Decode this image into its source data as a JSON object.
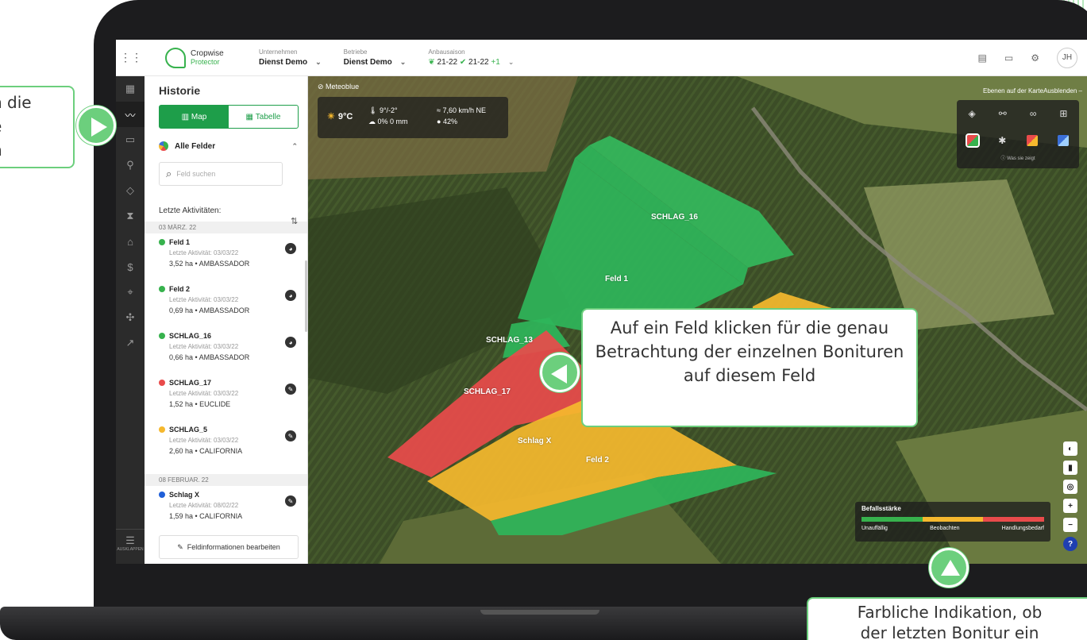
{
  "topbar": {
    "logo_name": "Cropwise",
    "logo_sub": "Protector",
    "unternehmen_label": "Unternehmen",
    "unternehmen_value": "Dienst Demo",
    "betriebe_label": "Betriebe",
    "betriebe_value": "Dienst Demo",
    "season_label": "Anbausaison",
    "season_a": "21-22",
    "season_b": "21-22",
    "season_more": "+1",
    "user_initials": "JH"
  },
  "panel": {
    "title": "Historie",
    "map_tab": "Map",
    "table_tab": "Tabelle",
    "filter": "Alle Felder",
    "search_placeholder": "Feld suchen",
    "recent_label": "Letzte Aktivitäten:",
    "date1": "03 MÄRZ. 22",
    "date2": "08 FEBRUAR. 22",
    "items": [
      {
        "name": "Feld 1",
        "activity": "Letzte Aktivität: 03/03/22",
        "info": "3,52 ha • AMBASSADOR",
        "color": "#37b24d"
      },
      {
        "name": "Feld 2",
        "activity": "Letzte Aktivität: 03/03/22",
        "info": "0,69 ha • AMBASSADOR",
        "color": "#37b24d"
      },
      {
        "name": "SCHLAG_16",
        "activity": "Letzte Aktivität: 03/03/22",
        "info": "0,66 ha • AMBASSADOR",
        "color": "#37b24d"
      },
      {
        "name": "SCHLAG_17",
        "activity": "Letzte Aktivität: 03/03/22",
        "info": "1,52 ha • EUCLIDE",
        "color": "#e94b4b"
      },
      {
        "name": "SCHLAG_5",
        "activity": "Letzte Aktivität: 03/03/22",
        "info": "2,60 ha • CALIFORNIA",
        "color": "#f5b82e"
      },
      {
        "name": "Schlag X",
        "activity": "Letzte Aktivität: 08/02/22",
        "info": "1,59 ha • CALIFORNIA",
        "color": "#1f5fd8"
      }
    ],
    "edit_button": "Feldinformationen bearbeiten",
    "collapse_label": "AUSKLAPPEN"
  },
  "map": {
    "meteo_label": "Meteoblue",
    "temp": "9°C",
    "temp_range": "9°/-2°",
    "rain": "0% 0 mm",
    "wind": "7,60 km/h NE",
    "humidity": "42%",
    "layers_label": "Ebenen auf der KarteAusblenden –",
    "layers_hint": "Was sie zeigt",
    "field_labels": {
      "schlag16": "SCHLAG_16",
      "feld1": "Feld 1",
      "schlag13": "SCHLAG_13",
      "schlag17": "SCHLAG_17",
      "schlagx": "Schlag X",
      "feld2": "Feld 2"
    },
    "legend": {
      "title": "Befallsstärke",
      "low": "Unauffällig",
      "mid": "Beobachten",
      "high": "Handlungsbedarf"
    }
  },
  "callouts": {
    "main": "Auf ein Feld klicken für die genau Betrachtung der einzelnen Bonituren auf diesem Feld",
    "left_line1": "n die",
    "left_line2": "e",
    "left_line3": "n",
    "bottom_line1": "Farbliche Indikation, ob",
    "bottom_line2": "der letzten Bonitur ein"
  },
  "colors": {
    "green": "#37b24d",
    "yellow": "#f5b82e",
    "red": "#e94b4b",
    "accent": "#1e9e4a",
    "callout_border": "#6ccf7d"
  }
}
